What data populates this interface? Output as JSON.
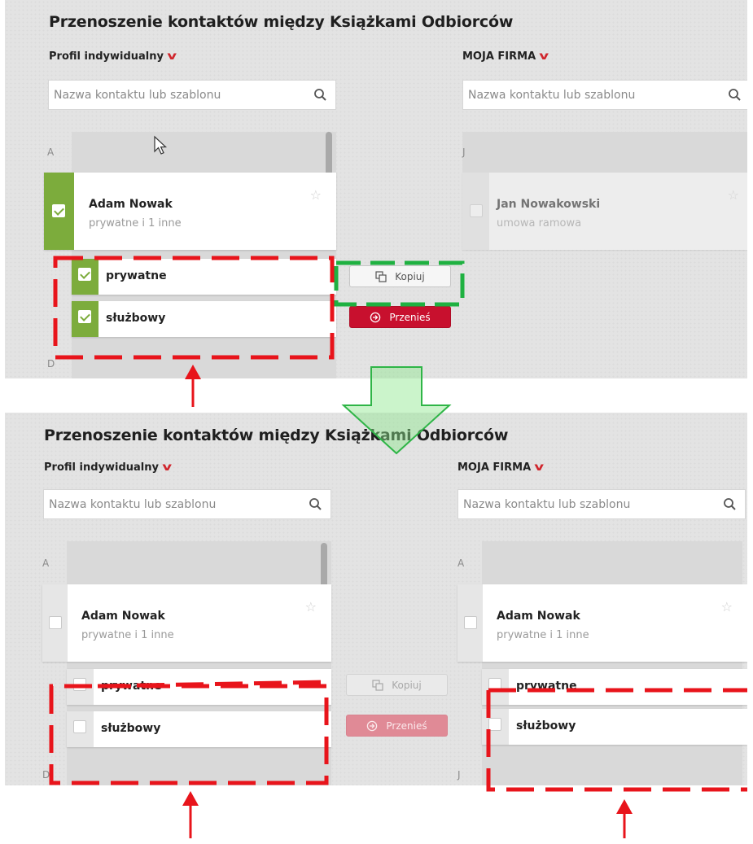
{
  "title": "Przenoszenie kontaktów między Książkami Odbiorców",
  "left_profile": "Profil indywidualny",
  "right_profile": "MOJA FIRMA",
  "search_placeholder": "Nazwa kontaktu lub szablonu",
  "letters": {
    "a": "A",
    "d": "D",
    "j": "J"
  },
  "contact": {
    "name": "Adam Nowak",
    "tag": "prywatne",
    "more": "i 1 inne"
  },
  "other_contact": {
    "name": "Jan Nowakowski",
    "sub": "umowa ramowa"
  },
  "subitems": [
    "prywatne",
    "służbowy"
  ],
  "buttons": {
    "copy": "Kopiuj",
    "move": "Przenieś"
  },
  "colors": {
    "accent_red": "#c8102e",
    "check_green": "#7cac3c",
    "annotation_red": "#e8141b",
    "annotation_green": "#1fb141"
  },
  "icons": [
    "search-icon",
    "chevron-down-icon",
    "star-icon",
    "check-icon",
    "copy-icon",
    "arrow-right-circle-icon",
    "mouse-cursor-icon"
  ]
}
